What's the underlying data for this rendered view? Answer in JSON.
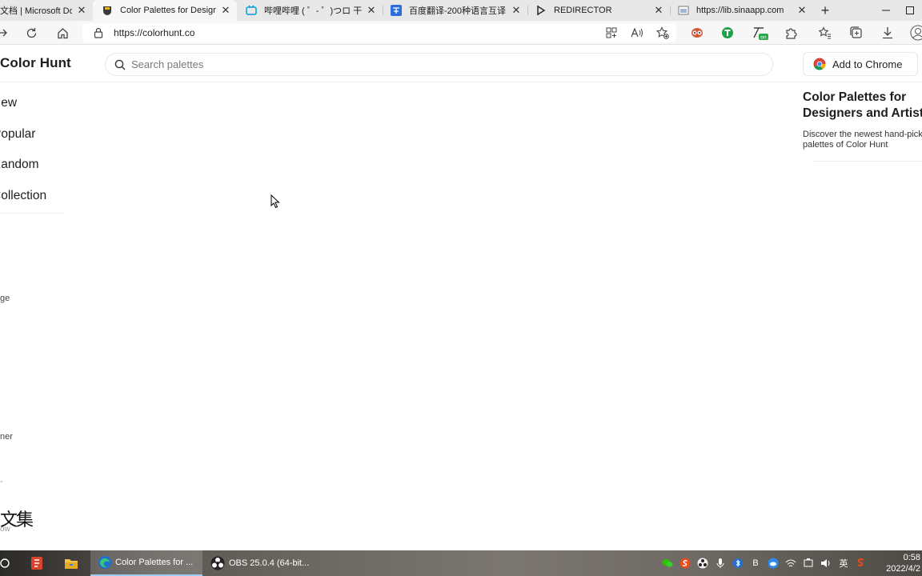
{
  "browser": {
    "tabs": [
      {
        "title": "文档 | Microsoft Docs",
        "active": false
      },
      {
        "title": "Color Palettes for Designers",
        "active": true
      },
      {
        "title": "哔哩哔哩 ( ゜- ゜)つロ 干杯",
        "active": false
      },
      {
        "title": "百度翻译-200种语言互译",
        "active": false
      },
      {
        "title": "REDIRECTOR",
        "active": false
      },
      {
        "title": "https://lib.sinaapp.com",
        "active": false
      }
    ],
    "close_glyph": "✕",
    "new_tab_glyph": "+",
    "address": "https://colorhunt.co"
  },
  "site": {
    "logo": "Color Hunt",
    "search_placeholder": "Search palettes",
    "add_to_chrome": "Add to Chrome",
    "nav": [
      {
        "label": "New"
      },
      {
        "label": "Popular"
      },
      {
        "label": "Random"
      },
      {
        "label": "Collection"
      }
    ],
    "side_fragments": [
      "ge",
      "ner",
      "-",
      "ow"
    ],
    "side_big": "文集",
    "panel_title_line1": "Color Palettes for",
    "panel_title_line2": "Designers and Artists",
    "panel_desc_line1": "Discover the newest hand-picked",
    "panel_desc_line2": "palettes of Color Hunt"
  },
  "taskbar": {
    "items": [
      {
        "label": "Color Palettes for ...",
        "active": true
      },
      {
        "label": "OBS 25.0.4 (64-bit...",
        "active": false
      }
    ],
    "tray_ime": "英",
    "tray_other": "B",
    "time": "0:58",
    "date": "2022/4/2"
  },
  "colors": {
    "tab_strip": "#e8e8e8",
    "toolbar": "#f7f7f7",
    "text": "#1e1e1e",
    "edge_blue": "#1f6fd1",
    "chrome_red": "#db4437",
    "chrome_green": "#0f9d58",
    "chrome_yellow": "#f4b400"
  }
}
